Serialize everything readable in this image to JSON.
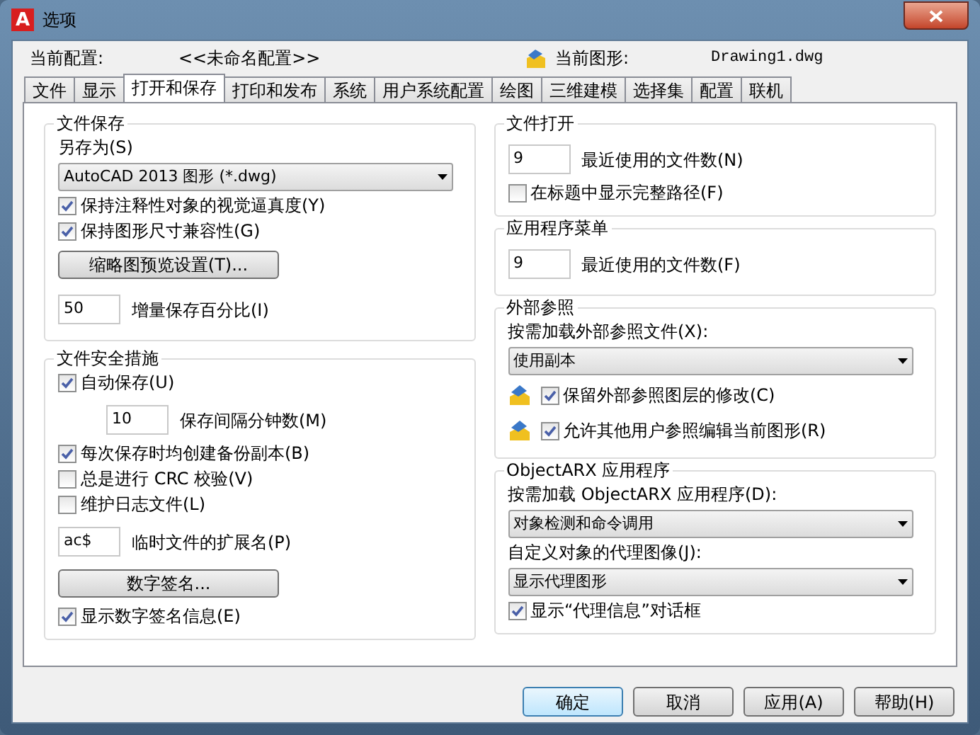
{
  "window": {
    "icon_letter": "A",
    "title": "选项"
  },
  "profile": {
    "label": "当前配置:",
    "value": "<<未命名配置>>",
    "drawing_label": "当前图形:",
    "drawing_value": "Drawing1.dwg"
  },
  "tabs": [
    {
      "label": "文件",
      "selected": false
    },
    {
      "label": "显示",
      "selected": false
    },
    {
      "label": "打开和保存",
      "selected": true
    },
    {
      "label": "打印和发布",
      "selected": false
    },
    {
      "label": "系统",
      "selected": false
    },
    {
      "label": "用户系统配置",
      "selected": false
    },
    {
      "label": "绘图",
      "selected": false
    },
    {
      "label": "三维建模",
      "selected": false
    },
    {
      "label": "选择集",
      "selected": false
    },
    {
      "label": "配置",
      "selected": false
    },
    {
      "label": "联机",
      "selected": false
    }
  ],
  "left_groups": [
    {
      "title": "文件保存",
      "items": [
        {
          "kind": "label",
          "text": "另存为(S)"
        },
        {
          "kind": "select",
          "value_parts": [
            "AutoCAD 2013 图形 (*.dwg)"
          ]
        },
        {
          "kind": "check",
          "label": "保持注释性对象的视觉逼真度(Y)",
          "checked": true
        },
        {
          "kind": "check",
          "label": "保持图形尺寸兼容性(G)",
          "checked": true
        },
        {
          "kind": "button",
          "label": "缩略图预览设置(T)..."
        },
        {
          "kind": "field",
          "number": "50",
          "caption": "增量保存百分比(I)"
        }
      ]
    },
    {
      "title": "文件安全措施",
      "items": [
        {
          "kind": "check",
          "label": "自动保存(U)",
          "checked": true
        },
        {
          "kind": "indented-field",
          "number": "10",
          "caption": "保存间隔分钟数(M)"
        },
        {
          "kind": "check",
          "label": "每次保存时均创建备份副本(B)",
          "checked": true
        },
        {
          "kind": "check",
          "label": "总是进行 CRC 校验(V)",
          "checked": false
        },
        {
          "kind": "check",
          "label": "维护日志文件(L)",
          "checked": false
        },
        {
          "kind": "field",
          "number": "ac$",
          "caption": "临时文件的扩展名(P)"
        },
        {
          "kind": "button",
          "label": "数字签名..."
        },
        {
          "kind": "check",
          "label": "显示数字签名信息(E)",
          "checked": true
        }
      ]
    }
  ],
  "right_groups": [
    {
      "title": "文件打开",
      "items": [
        {
          "kind": "field",
          "number": "9",
          "caption": "最近使用的文件数(N)"
        },
        {
          "kind": "check",
          "label": "在标题中显示完整路径(F)",
          "checked": false
        }
      ]
    },
    {
      "title": "应用程序菜单",
      "items": [
        {
          "kind": "field",
          "number": "9",
          "caption": "最近使用的文件数(F)"
        }
      ]
    },
    {
      "title": "外部参照",
      "items": [
        {
          "kind": "label",
          "text": "按需加载外部参照文件(X):"
        },
        {
          "kind": "select",
          "value_parts": [
            "使用副本"
          ]
        },
        {
          "kind": "icon-check",
          "label": "保留外部参照图层的修改(C)",
          "checked": true
        },
        {
          "kind": "icon-check",
          "label": "允许其他用户参照编辑当前图形(R)",
          "checked": true
        }
      ]
    },
    {
      "title": "ObjectARX 应用程序",
      "items": [
        {
          "kind": "label",
          "text": "按需加载 ObjectARX 应用程序(D):"
        },
        {
          "kind": "select",
          "value_parts": [
            "对象检测和命令调用"
          ]
        },
        {
          "kind": "label",
          "text": "自定义对象的代理图像(J):"
        },
        {
          "kind": "select",
          "value_parts": [
            "显示代理图形"
          ]
        },
        {
          "kind": "check",
          "label": "显示“代理信息”对话框",
          "checked": true
        }
      ]
    }
  ],
  "buttons": [
    {
      "label": "确定",
      "default": true
    },
    {
      "label": "取消",
      "default": false
    },
    {
      "label": "应用(A)",
      "default": false
    },
    {
      "label": "帮助(H)",
      "default": false
    }
  ]
}
